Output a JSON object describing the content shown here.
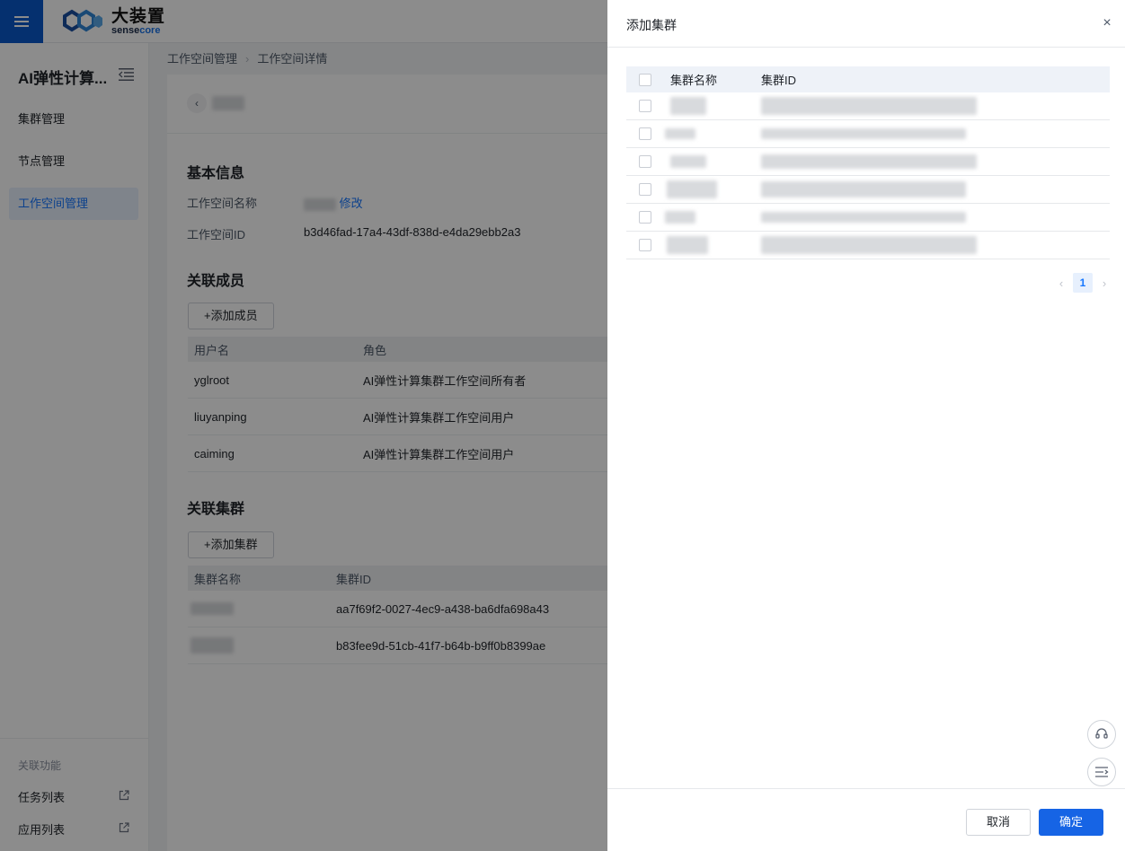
{
  "brand": {
    "name_cn": "大装置",
    "name_en_a": "sense",
    "name_en_b": "core"
  },
  "sidebar": {
    "title": "AI弹性计算...",
    "items": [
      {
        "label": "集群管理"
      },
      {
        "label": "节点管理"
      },
      {
        "label": "工作空间管理"
      }
    ],
    "related_label": "关联功能",
    "related_links": [
      {
        "label": "任务列表"
      },
      {
        "label": "应用列表"
      }
    ]
  },
  "breadcrumb": {
    "parent": "工作空间管理",
    "current": "工作空间详情"
  },
  "detail": {
    "basic_info_title": "基本信息",
    "name_label": "工作空间名称",
    "edit_link": "修改",
    "id_label": "工作空间ID",
    "id_value": "b3d46fad-17a4-43df-838d-e4da29ebb2a3",
    "members_title": "关联成员",
    "add_member_button": "+添加成员",
    "members_columns": [
      "用户名",
      "角色"
    ],
    "members": [
      {
        "username": "yglroot",
        "role": "AI弹性计算集群工作空间所有者"
      },
      {
        "username": "liuyanping",
        "role": "AI弹性计算集群工作空间用户"
      },
      {
        "username": "caiming",
        "role": "AI弹性计算集群工作空间用户"
      }
    ],
    "clusters_title": "关联集群",
    "add_cluster_button": "+添加集群",
    "clusters_columns": [
      "集群名称",
      "集群ID"
    ],
    "clusters": [
      {
        "id": "aa7f69f2-0027-4ec9-a438-ba6dfa698a43"
      },
      {
        "id": "b83fee9d-51cb-41f7-b64b-b9ff0b8399ae"
      }
    ]
  },
  "drawer": {
    "title": "添加集群",
    "columns": [
      "集群名称",
      "集群ID"
    ],
    "row_count": 6,
    "page_current": "1",
    "cancel_button": "取消",
    "confirm_button": "确定"
  },
  "colors": {
    "accent": "#1677ff",
    "brand_blue": "#0a58ca",
    "primary_button": "#1664e5"
  }
}
